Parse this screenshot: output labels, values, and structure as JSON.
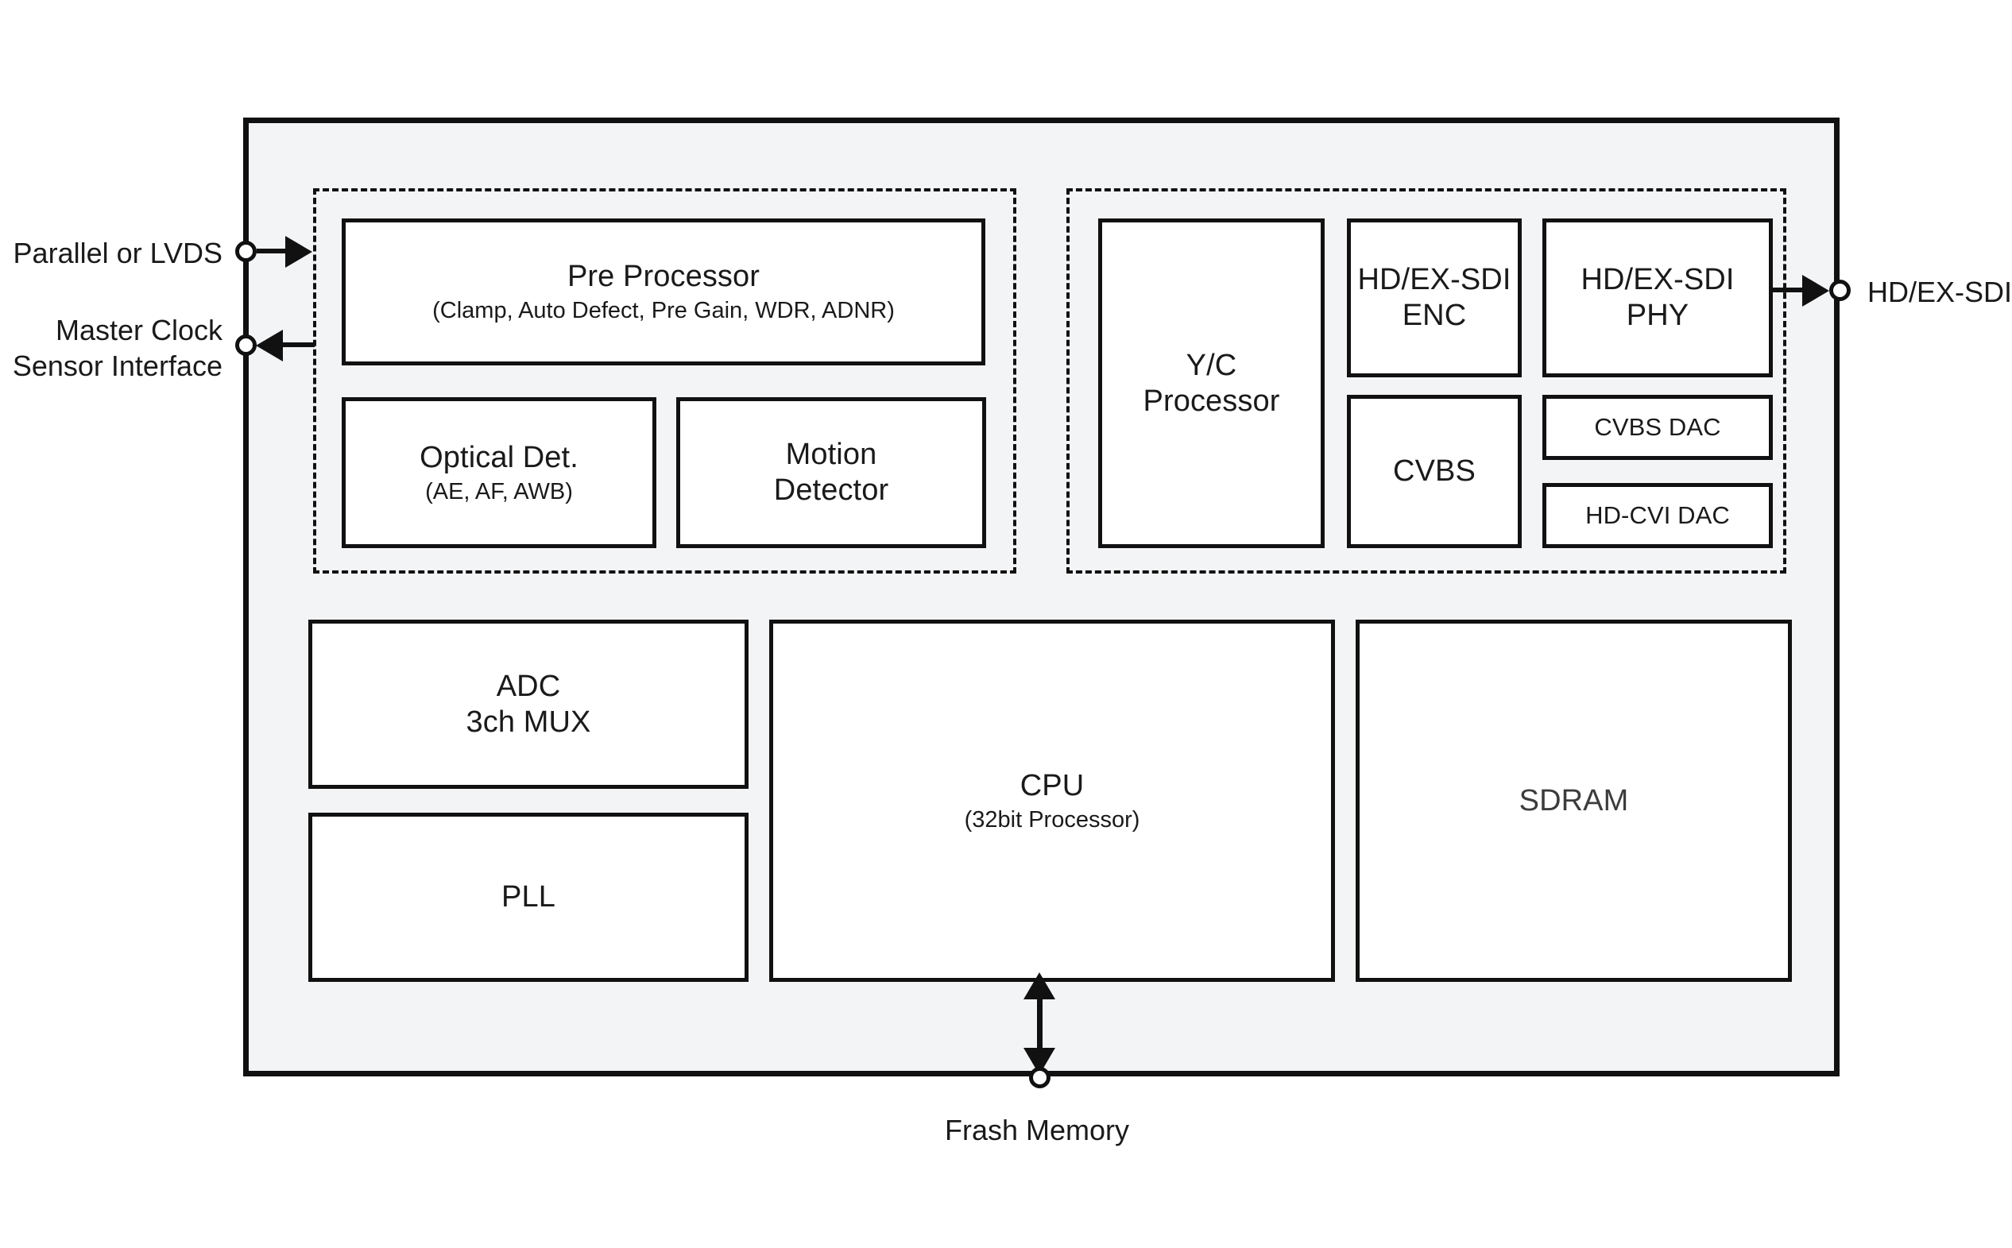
{
  "diagram": {
    "type": "block-diagram",
    "background_color": "#ffffff",
    "die_fill_color": "#f3f4f6",
    "line_color": "#111111",
    "block_fill_color": "#ffffff"
  },
  "chip": {
    "isp_group_label": "",
    "output_group_label": ""
  },
  "blocks": {
    "pre_processor": {
      "title": "Pre Processor",
      "subtitle": "(Clamp, Auto Defect, Pre Gain, WDR, ADNR)"
    },
    "optical_det": {
      "title": "Optical Det.",
      "subtitle": "(AE, AF, AWB)"
    },
    "motion_detector": {
      "title": "Motion\nDetector"
    },
    "yc_processor": {
      "title": "Y/C\nProcessor"
    },
    "hd_ex_sdi_enc": {
      "title": "HD/EX-SDI\nENC"
    },
    "hd_ex_sdi_phy": {
      "title": "HD/EX-SDI\nPHY"
    },
    "cvbs": {
      "title": "CVBS"
    },
    "cvbs_dac": {
      "title": "CVBS DAC"
    },
    "hd_cvi_dac": {
      "title": "HD-CVI DAC"
    },
    "adc_mux": {
      "title": "ADC\n3ch MUX"
    },
    "pll": {
      "title": "PLL"
    },
    "cpu": {
      "title": "CPU",
      "subtitle": "(32bit Processor)"
    },
    "sdram": {
      "title": "SDRAM"
    }
  },
  "ports": {
    "parallel_lvds": {
      "label": "Parallel or LVDS",
      "direction": "input"
    },
    "master_clock_sensor_interface": {
      "label": "Master Clock\nSensor Interface",
      "direction": "output"
    },
    "hd_ex_sdi_out": {
      "label": "HD/EX-SDI",
      "direction": "output"
    },
    "frash_memory": {
      "label": "Frash Memory",
      "direction": "bidirectional"
    }
  }
}
